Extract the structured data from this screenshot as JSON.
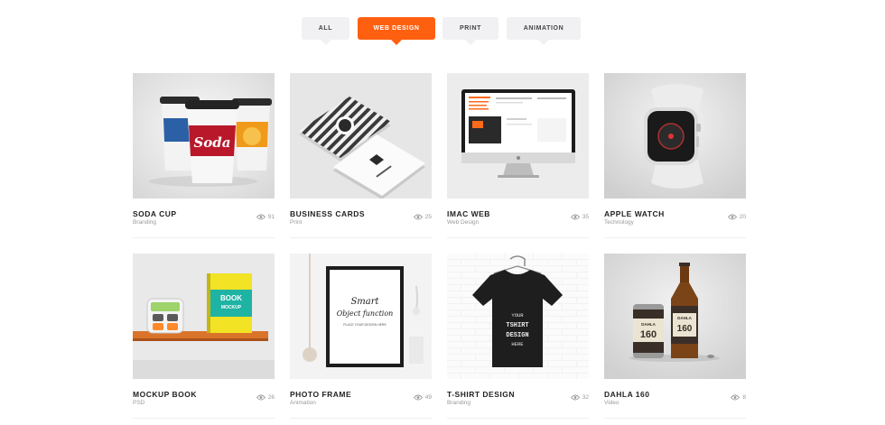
{
  "filters": [
    {
      "label": "ALL",
      "active": false
    },
    {
      "label": "WEB DESIGN",
      "active": true
    },
    {
      "label": "PRINT",
      "active": false
    },
    {
      "label": "ANIMATION",
      "active": false
    }
  ],
  "items": [
    {
      "title": "SODA CUP",
      "category": "Branding",
      "views": "91"
    },
    {
      "title": "BUSINESS CARDS",
      "category": "Print",
      "views": "25"
    },
    {
      "title": "IMAC WEB",
      "category": "Web Design",
      "views": "35"
    },
    {
      "title": "APPLE WATCH",
      "category": "Technology",
      "views": "20"
    },
    {
      "title": "MOCKUP BOOK",
      "category": "PSD",
      "views": "26"
    },
    {
      "title": "PHOTO FRAME",
      "category": "Animation",
      "views": "49"
    },
    {
      "title": "T-SHIRT DESIGN",
      "category": "Branding",
      "views": "32"
    },
    {
      "title": "DAHLA 160",
      "category": "Video",
      "views": "8"
    }
  ],
  "image_text": {
    "soda": "Soda",
    "book_title": "BOOK",
    "book_sub": "MOCKUP",
    "frame_line1": "Smart",
    "frame_line2": "Object function",
    "frame_line3": "PLACE YOUR DESIGN HERE",
    "shirt_line1": "YOUR",
    "shirt_line2": "TSHIRT",
    "shirt_line3": "DESIGN",
    "shirt_line4": "HERE",
    "beer_brand": "DAHLA",
    "beer_number": "160"
  },
  "colors": {
    "accent": "#ff6010",
    "filter_bg": "#f1f1f3"
  },
  "icons": {
    "views": "eye-icon"
  }
}
